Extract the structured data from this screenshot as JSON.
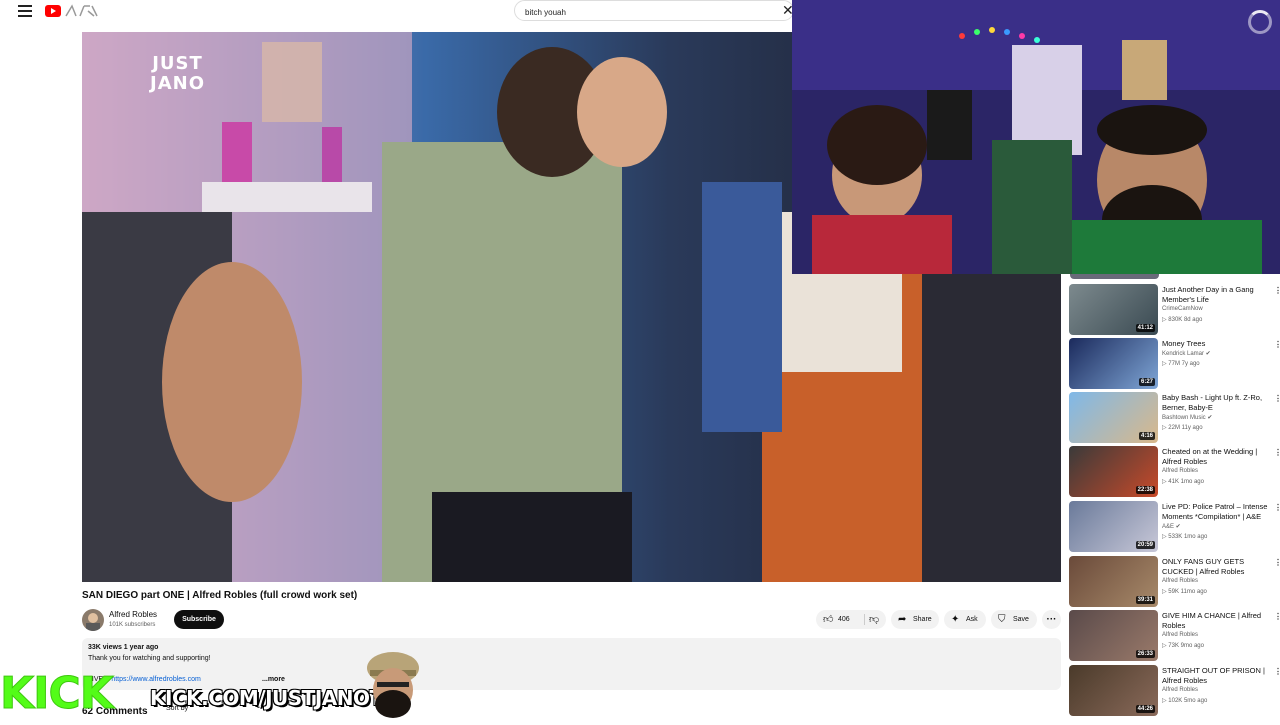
{
  "header": {
    "search_value": "bitch youah",
    "search_clear": "✕"
  },
  "video": {
    "title": "SAN DIEGO part ONE | Alfred Robles (full crowd work set)",
    "channel": "Alfred Robles",
    "subscribers": "101K subscribers",
    "subscribe_label": "Subscribe",
    "likes": "406",
    "share_label": "Share",
    "ask_label": "Ask",
    "save_label": "Save",
    "more_label": "···"
  },
  "description": {
    "meta": "33K views  1 year ago",
    "line1": "Thank you for watching and supporting!",
    "line2_prefix": "LIVE! · ",
    "link": "https://www.alfredrobles.com",
    "more": "...more"
  },
  "comments": {
    "count": "62 Comments",
    "sort": "Sort by"
  },
  "webcam": {
    "sign": "JUST\nJANO"
  },
  "kick": {
    "logo": "KICK",
    "url": "KICK.COM/JUSTJANOTV"
  },
  "recommendations": [
    {
      "title": "Just Another Day in a Gang Member's Life",
      "channel": "CrimeCamNow",
      "meta": "▷ 830K  8d ago",
      "duration": "41:12",
      "colors": [
        "#7d8a8e",
        "#3a4a52"
      ],
      "verified": false
    },
    {
      "title": "Money Trees",
      "channel": "Kendrick Lamar",
      "meta": "▷ 77M  7y ago",
      "duration": "6:27",
      "colors": [
        "#1b2a5c",
        "#7fa6d6"
      ],
      "verified": true
    },
    {
      "title": "Baby Bash - Light Up ft. Z-Ro, Berner, Baby-E",
      "channel": "Bashtown Music",
      "meta": "▷ 22M  11y ago",
      "duration": "4:16",
      "colors": [
        "#7fb8e8",
        "#d9b88a"
      ],
      "verified": true
    },
    {
      "title": "Cheated on at the Wedding | Alfred Robles",
      "channel": "Alfred Robles",
      "meta": "▷ 41K  1mo ago",
      "duration": "22:38",
      "colors": [
        "#3a3a3a",
        "#c84a2a"
      ],
      "verified": false
    },
    {
      "title": "Live PD: Police Patrol – Intense Moments *Compilation* | A&E",
      "channel": "A&E",
      "meta": "▷ 533K  1mo ago",
      "duration": "20:59",
      "colors": [
        "#6a7a9a",
        "#c8c8d8"
      ],
      "verified": true
    },
    {
      "title": "ONLY FANS GUY GETS CUCKED | Alfred Robles",
      "channel": "Alfred Robles",
      "meta": "▷ 59K  11mo ago",
      "duration": "39:31",
      "colors": [
        "#6a4a3a",
        "#a88a6a"
      ],
      "verified": false
    },
    {
      "title": "GIVE HIM A CHANCE | Alfred Robles",
      "channel": "Alfred Robles",
      "meta": "▷ 73K  9mo ago",
      "duration": "26:33",
      "colors": [
        "#5a4a4a",
        "#9a7a6a"
      ],
      "verified": false
    },
    {
      "title": "STRAIGHT OUT OF PRISON | Alfred Robles",
      "channel": "Alfred Robles",
      "meta": "▷ 102K  5mo ago",
      "duration": "44:26",
      "colors": [
        "#4a3a2a",
        "#8a6a5a"
      ],
      "verified": false
    }
  ]
}
